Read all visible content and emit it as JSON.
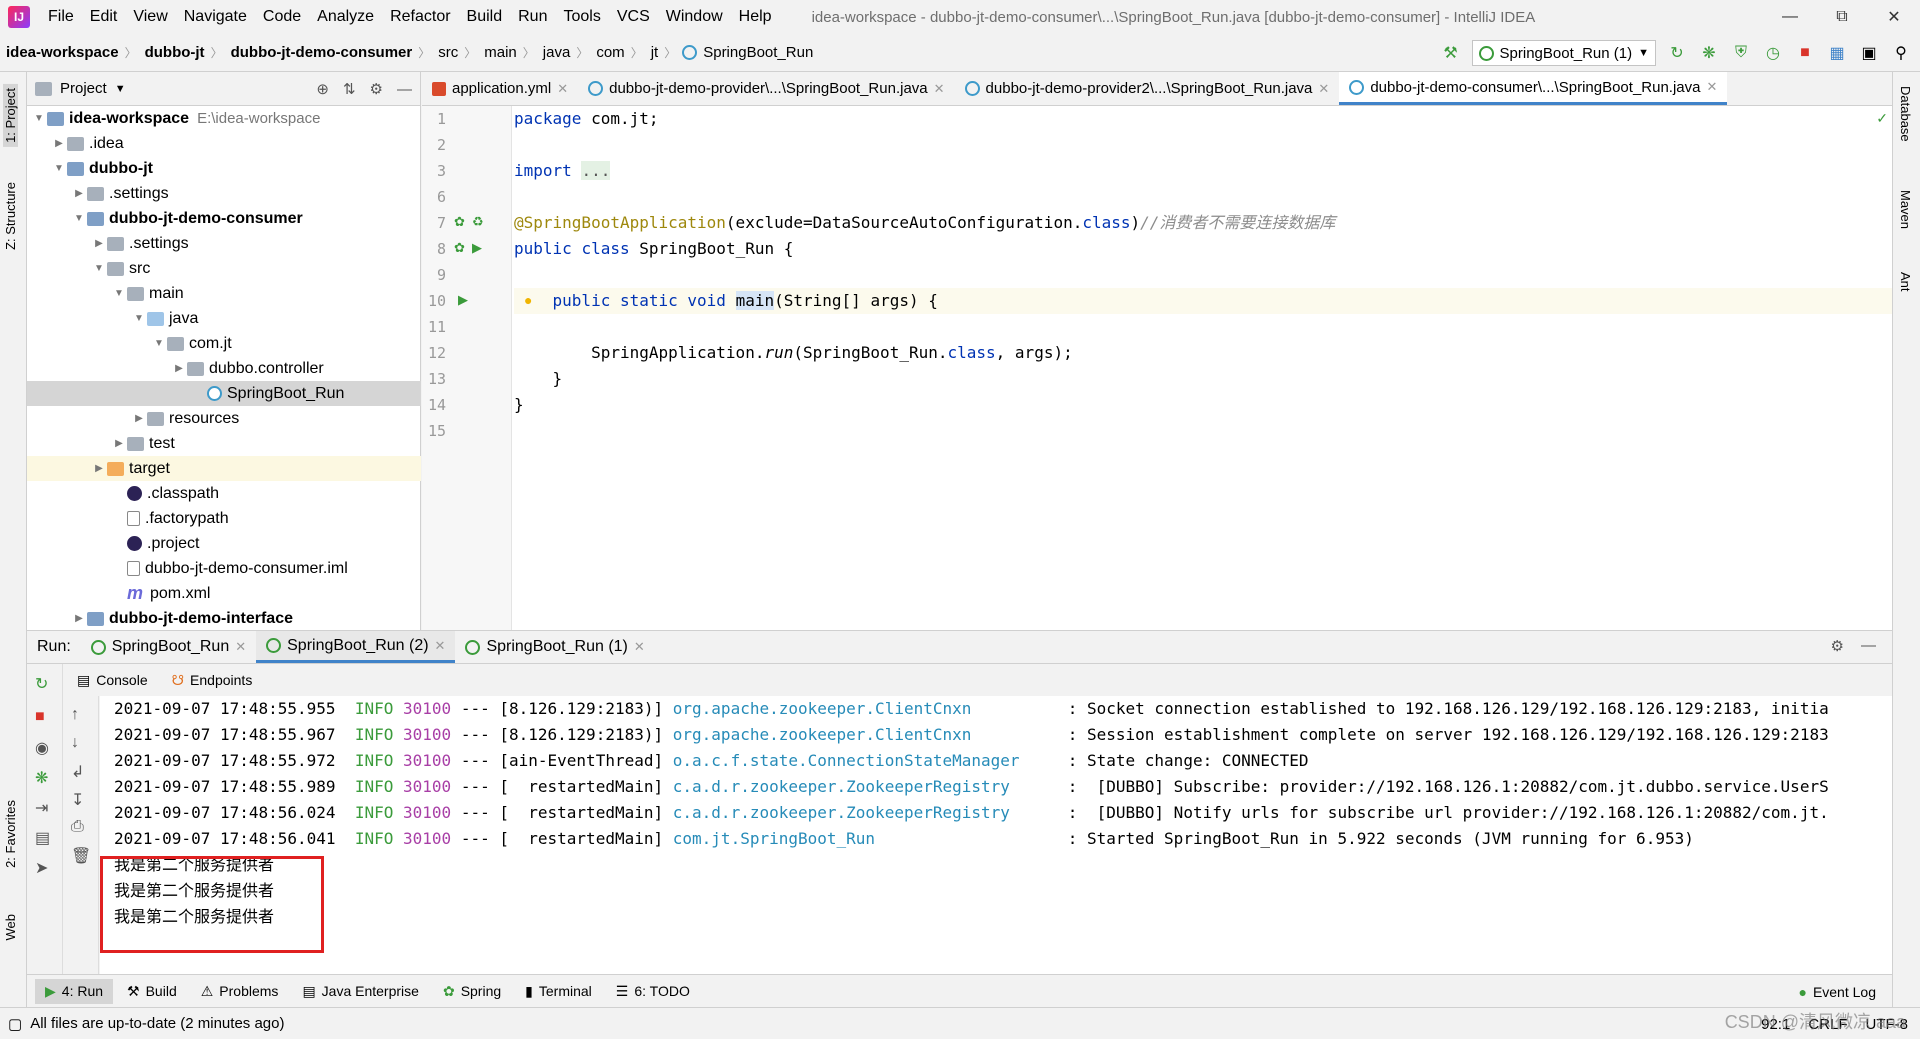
{
  "app": {
    "window_title": "idea-workspace - dubbo-jt-demo-consumer\\...\\SpringBoot_Run.java [dubbo-jt-demo-consumer] - IntelliJ IDEA",
    "logo_text": "IJ"
  },
  "menu": [
    "File",
    "Edit",
    "View",
    "Navigate",
    "Code",
    "Analyze",
    "Refactor",
    "Build",
    "Run",
    "Tools",
    "VCS",
    "Window",
    "Help"
  ],
  "breadcrumb": [
    "idea-workspace",
    "dubbo-jt",
    "dubbo-jt-demo-consumer",
    "src",
    "main",
    "java",
    "com",
    "jt",
    "SpringBoot_Run"
  ],
  "run_config": "SpringBoot_Run (1)",
  "left_strip": {
    "project": "1: Project",
    "structure": "Z: Structure",
    "favorites": "2: Favorites",
    "web": "Web"
  },
  "right_strip": {
    "database": "Database",
    "maven": "Maven",
    "ant": "Ant"
  },
  "project_panel": {
    "title": "Project",
    "tree": [
      {
        "label": "idea-workspace",
        "hint": "E:\\idea-workspace",
        "bold": true
      },
      {
        "label": ".idea"
      },
      {
        "label": "dubbo-jt",
        "bold": true
      },
      {
        "label": ".settings"
      },
      {
        "label": "dubbo-jt-demo-consumer",
        "bold": true
      },
      {
        "label": ".settings"
      },
      {
        "label": "src"
      },
      {
        "label": "main"
      },
      {
        "label": "java"
      },
      {
        "label": "com.jt"
      },
      {
        "label": "dubbo.controller"
      },
      {
        "label": "SpringBoot_Run"
      },
      {
        "label": "resources"
      },
      {
        "label": "test"
      },
      {
        "label": "target"
      },
      {
        "label": ".classpath"
      },
      {
        "label": ".factorypath"
      },
      {
        "label": ".project"
      },
      {
        "label": "dubbo-jt-demo-consumer.iml"
      },
      {
        "label": "pom.xml"
      },
      {
        "label": "dubbo-jt-demo-interface",
        "bold": true
      }
    ]
  },
  "editor_tabs": [
    {
      "label": "application.yml"
    },
    {
      "label": "dubbo-jt-demo-provider\\...\\SpringBoot_Run.java"
    },
    {
      "label": "dubbo-jt-demo-provider2\\...\\SpringBoot_Run.java"
    },
    {
      "label": "dubbo-jt-demo-consumer\\...\\SpringBoot_Run.java"
    }
  ],
  "code": {
    "line_numbers": [
      "1",
      "2",
      "3",
      "6",
      "7",
      "8",
      "9",
      "10",
      "11",
      "12",
      "13",
      "14",
      "15"
    ],
    "package_kw": "package",
    "package_name": " com.jt;",
    "import_kw": "import",
    "import_fold": "...",
    "annotation": "@SpringBootApplication",
    "annotation_args_open": "(exclude=DataSourceAutoConfiguration.",
    "class_kw": "class",
    "annotation_args_close": ")",
    "comment": "//消费者不需要连接数据库",
    "public_kw": "public",
    "class_decl": " SpringBoot_Run {",
    "static_kw": "static",
    "void_kw": "void",
    "main_name": "main",
    "main_params": "(String[] args) {",
    "run_obj": "SpringApplication.",
    "run_method": "run",
    "run_args_open": "(SpringBoot_Run.",
    "run_args_close": ", args);",
    "close_inner": "}",
    "close_outer": "}"
  },
  "run_panel": {
    "label": "Run:",
    "tabs": [
      "SpringBoot_Run",
      "SpringBoot_Run (2)",
      "SpringBoot_Run (1)"
    ],
    "subtabs": [
      "Console",
      "Endpoints"
    ],
    "logs": [
      {
        "ts": "2021-09-07 17:48:55.955",
        "level": "INFO",
        "pid": "30100",
        "sep": "---",
        "thread": "[8.126.129:2183)]",
        "logger": "org.apache.zookeeper.ClientCnxn       ",
        "msg": ": Socket connection established to 192.168.126.129/192.168.126.129:2183, initia"
      },
      {
        "ts": "2021-09-07 17:48:55.967",
        "level": "INFO",
        "pid": "30100",
        "sep": "---",
        "thread": "[8.126.129:2183)]",
        "logger": "org.apache.zookeeper.ClientCnxn       ",
        "msg": ": Session establishment complete on server 192.168.126.129/192.168.126.129:2183"
      },
      {
        "ts": "2021-09-07 17:48:55.972",
        "level": "INFO",
        "pid": "30100",
        "sep": "---",
        "thread": "[ain-EventThread]",
        "logger": "o.a.c.f.state.ConnectionStateManager  ",
        "msg": ": State change: CONNECTED"
      },
      {
        "ts": "2021-09-07 17:48:55.989",
        "level": "INFO",
        "pid": "30100",
        "sep": "---",
        "thread": "[  restartedMain]",
        "logger": "c.a.d.r.zookeeper.ZookeeperRegistry   ",
        "msg": ":  [DUBBO] Subscribe: provider://192.168.126.1:20882/com.jt.dubbo.service.UserS"
      },
      {
        "ts": "2021-09-07 17:48:56.024",
        "level": "INFO",
        "pid": "30100",
        "sep": "---",
        "thread": "[  restartedMain]",
        "logger": "c.a.d.r.zookeeper.ZookeeperRegistry   ",
        "msg": ":  [DUBBO] Notify urls for subscribe url provider://192.168.126.1:20882/com.jt."
      },
      {
        "ts": "2021-09-07 17:48:56.041",
        "level": "INFO",
        "pid": "30100",
        "sep": "---",
        "thread": "[  restartedMain]",
        "logger": "com.jt.SpringBoot_Run                 ",
        "msg": ": Started SpringBoot_Run in 5.922 seconds (JVM running for 6.953)"
      }
    ],
    "output_lines": [
      "我是第二个服务提供者",
      "我是第二个服务提供者",
      "我是第二个服务提供者"
    ]
  },
  "tool_windows": [
    "4: Run",
    "Build",
    "Problems",
    "Java Enterprise",
    "Spring",
    "Terminal",
    "6: TODO"
  ],
  "event_log": "Event Log",
  "status": {
    "message": "All files are up-to-date (2 minutes ago)",
    "position": "92:1",
    "line_sep": "CRLF",
    "encoding": "UTF-8",
    "watermark": "CSDN @清风微凉 aaa"
  },
  "colors": {
    "accent": "#4083c9",
    "highlight_box": "#e02020",
    "log_level": "#3b9b3b",
    "pid": "#a83ea6",
    "logger": "#268bb8"
  }
}
